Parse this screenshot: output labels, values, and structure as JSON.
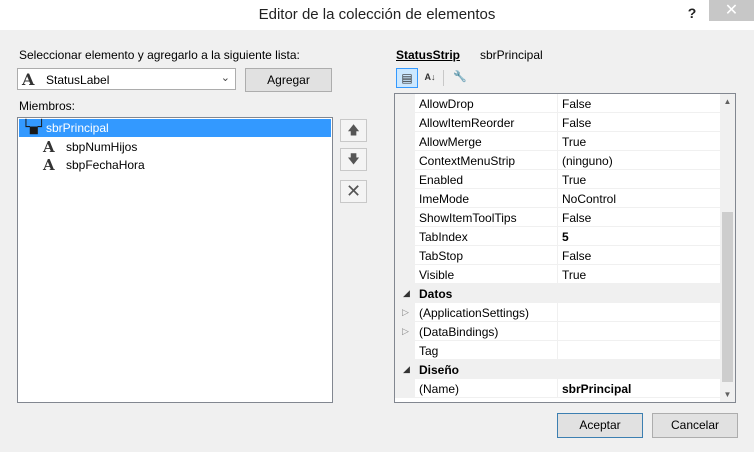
{
  "dialog": {
    "title": "Editor de la colección de elementos",
    "help": "?",
    "close": "✕"
  },
  "left": {
    "select_label": "Seleccionar elemento y agregarlo a la siguiente lista:",
    "combo_value": "StatusLabel",
    "add_button": "Agregar",
    "members_label": "Miembros:",
    "members": [
      {
        "label": "sbrPrincipal",
        "icon": "statusstrip-icon",
        "selected": true
      },
      {
        "label": "sbpNumHijos",
        "icon": "label-a-icon",
        "selected": false
      },
      {
        "label": "sbpFechaHora",
        "icon": "label-a-icon",
        "selected": false
      }
    ]
  },
  "right": {
    "component_type": "StatusStrip",
    "component_name": "sbrPrincipal",
    "properties": [
      {
        "name": "AllowDrop",
        "value": "False"
      },
      {
        "name": "AllowItemReorder",
        "value": "False"
      },
      {
        "name": "AllowMerge",
        "value": "True"
      },
      {
        "name": "ContextMenuStrip",
        "value": "(ninguno)"
      },
      {
        "name": "Enabled",
        "value": "True"
      },
      {
        "name": "ImeMode",
        "value": "NoControl"
      },
      {
        "name": "ShowItemToolTips",
        "value": "False"
      },
      {
        "name": "TabIndex",
        "value": "5"
      },
      {
        "name": "TabStop",
        "value": "False"
      },
      {
        "name": "Visible",
        "value": "True"
      }
    ],
    "category_datos": "Datos",
    "datos_props": [
      {
        "name": "(ApplicationSettings)",
        "value": ""
      },
      {
        "name": "(DataBindings)",
        "value": ""
      },
      {
        "name": "Tag",
        "value": ""
      }
    ],
    "category_diseno": "Diseño",
    "diseno_props": [
      {
        "name": "(Name)",
        "value": "sbrPrincipal"
      }
    ]
  },
  "footer": {
    "accept": "Aceptar",
    "cancel": "Cancelar"
  },
  "colors": {
    "selection": "#3399ff",
    "accent_border": "#3c7fb1"
  }
}
